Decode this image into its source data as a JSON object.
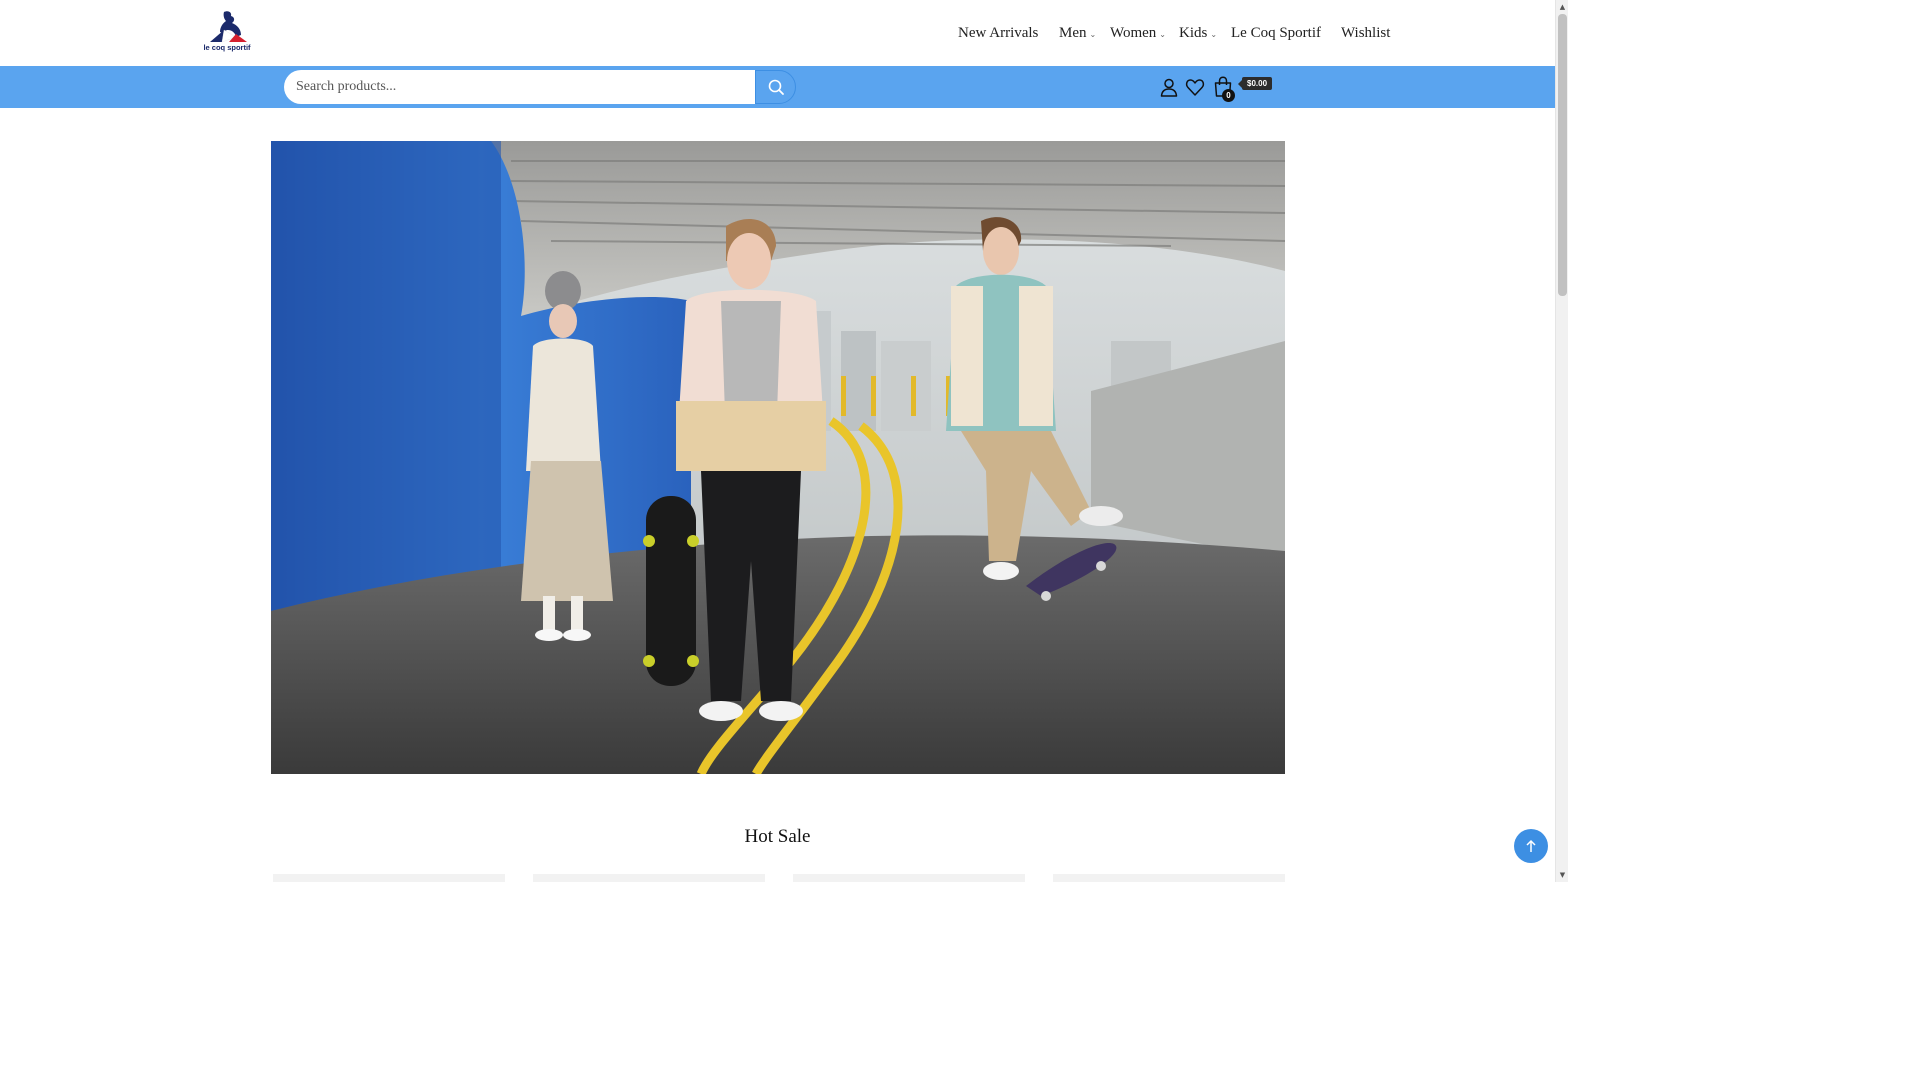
{
  "header": {
    "logo_text": "le coq sportif",
    "nav": [
      {
        "label": "New Arrivals",
        "has_dropdown": false
      },
      {
        "label": "Men",
        "has_dropdown": true
      },
      {
        "label": "Women",
        "has_dropdown": true
      },
      {
        "label": "Kids",
        "has_dropdown": true
      },
      {
        "label": "Le Coq Sportif",
        "has_dropdown": false
      },
      {
        "label": "Wishlist",
        "has_dropdown": false
      }
    ]
  },
  "search": {
    "placeholder": "Search products...",
    "value": ""
  },
  "cart": {
    "count": "0",
    "total": "$0.00"
  },
  "icons": {
    "account": "user-icon",
    "wishlist": "heart-icon",
    "cart": "shopping-bag-icon",
    "search": "search-icon",
    "back_to_top": "arrow-up-icon"
  },
  "hot_sale": {
    "title": "Hot Sale"
  },
  "colors": {
    "accent": "#5aa4ef",
    "accent_dark": "#3d8fe3",
    "logo_blue": "#1b2a6b",
    "logo_red": "#d6202e"
  }
}
